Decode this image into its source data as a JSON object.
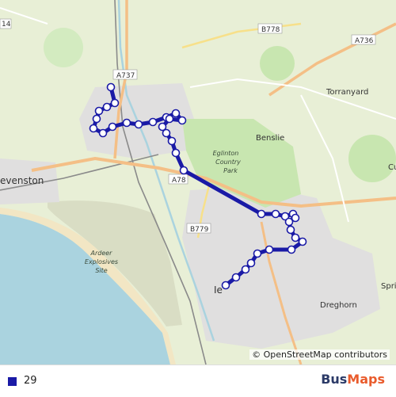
{
  "map": {
    "attribution": "© OpenStreetMap contributors",
    "road_labels": [
      "14",
      "B778",
      "A736",
      "A737",
      "A78",
      "B779"
    ],
    "place_labels": [
      "Torranyard",
      "Benslie",
      "evenston",
      "Cu",
      "Spri",
      "Dreghorn",
      "Ie"
    ],
    "park_label_lines": [
      "Eglinton",
      "Country",
      "Park"
    ],
    "ardeer_label_lines": [
      "Ardeer",
      "Explosives",
      "Site"
    ],
    "route_color": "#1a1aa6"
  },
  "legend": {
    "route_label": "29",
    "route_color": "#1a1aa6"
  },
  "brand": {
    "part1": "Bus",
    "part2": "Maps",
    "color1": "#2b3a67",
    "color2": "#e95b2c"
  }
}
